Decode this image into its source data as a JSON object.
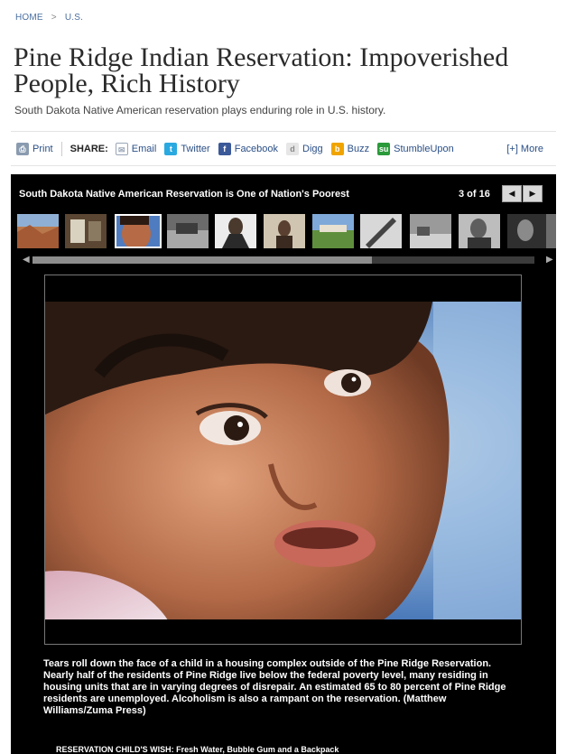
{
  "breadcrumb": {
    "home": "HOME",
    "separator": ">",
    "section": "U.S."
  },
  "article": {
    "title": "Pine Ridge Indian Reservation: Impoverished People, Rich History",
    "subtitle": "South Dakota Native American reservation plays enduring role in U.S. history."
  },
  "share_bar": {
    "print": "Print",
    "share_label": "SHARE:",
    "items": [
      {
        "label": "Email",
        "icon": "email-icon",
        "color": "#9aa6b8"
      },
      {
        "label": "Twitter",
        "icon": "twitter-icon",
        "color": "#2aa9e0"
      },
      {
        "label": "Facebook",
        "icon": "facebook-icon",
        "color": "#3b5998"
      },
      {
        "label": "Digg",
        "icon": "digg-icon",
        "color": "#c8c8c8"
      },
      {
        "label": "Buzz",
        "icon": "buzz-icon",
        "color": "#f0a400"
      },
      {
        "label": "StumbleUpon",
        "icon": "stumbleupon-icon",
        "color": "#2b9a3a"
      }
    ],
    "more": "[+] More"
  },
  "gallery": {
    "heading": "South Dakota Native American Reservation is One of Nation's Poorest",
    "counter": "3 of 16",
    "prev_icon": "arrow-left-icon",
    "next_icon": "arrow-right-icon",
    "thumbnail_count": 12,
    "selected_index": 2,
    "scroll_fraction": 0.68,
    "caption": "Tears roll down the face of a child in a housing complex outside of the Pine Ridge Reservation. Nearly half of the residents of Pine Ridge live below the federal poverty level, many residing in housing units that are in varying degrees of disrepair. An estimated 65 to 80 percent of Pine Ridge residents are unemployed. Alcoholism is also a rampant on the reservation. (Matthew Williams/Zuma Press)",
    "next_caption": "RESERVATION CHILD'S WISH: Fresh Water, Bubble Gum and a Backpack"
  },
  "colors": {
    "link": "#4a6fa0",
    "gallery_bg": "#000000",
    "caption": "#ffffff"
  }
}
